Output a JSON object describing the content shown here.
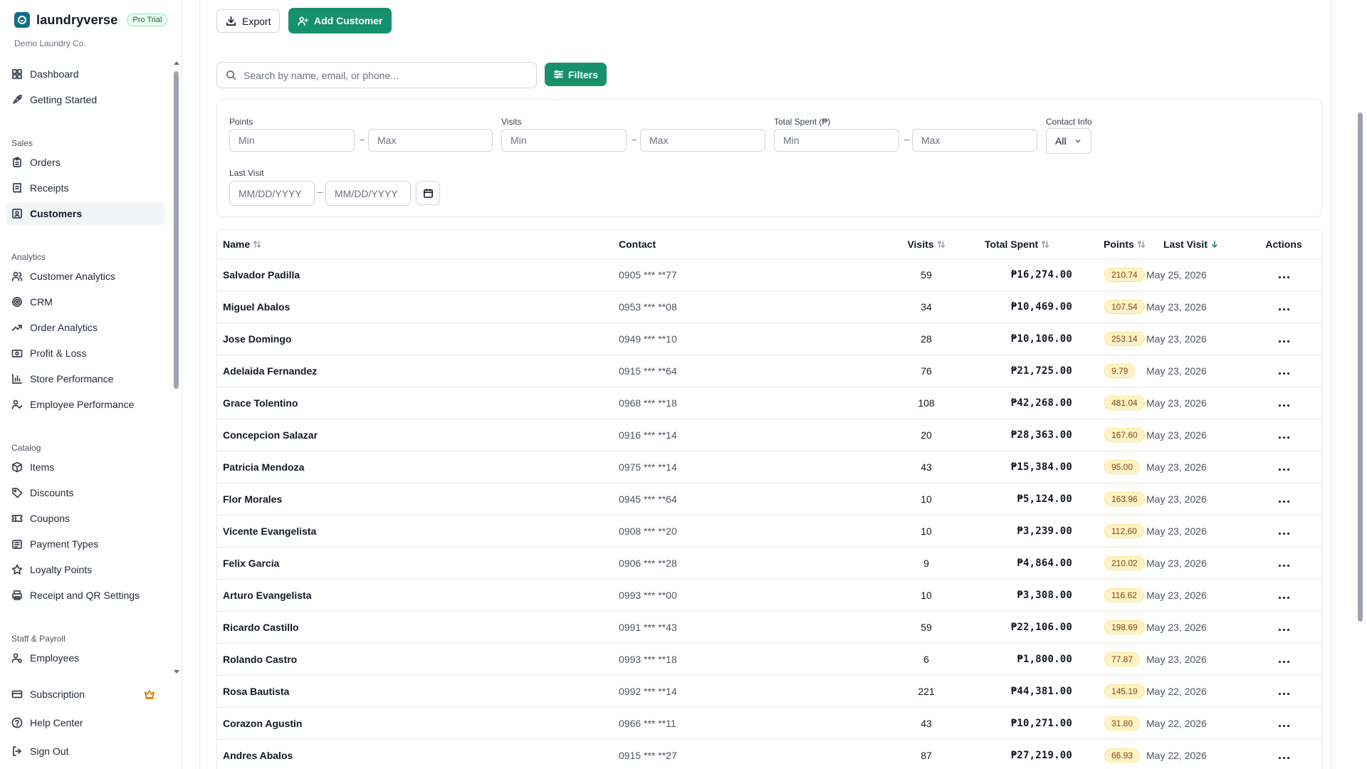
{
  "brand": {
    "name": "laundryverse",
    "badge": "Pro Trial",
    "company": "Demo Laundry Co."
  },
  "sidebar": {
    "top_items": [
      {
        "label": "Dashboard",
        "icon": "grid-icon"
      },
      {
        "label": "Getting Started",
        "icon": "rocket-icon"
      }
    ],
    "sections": [
      {
        "title": "Sales",
        "items": [
          {
            "label": "Orders",
            "icon": "clipboard-icon"
          },
          {
            "label": "Receipts",
            "icon": "receipt-icon"
          },
          {
            "label": "Customers",
            "icon": "contact-icon",
            "active": true
          }
        ]
      },
      {
        "title": "Analytics",
        "items": [
          {
            "label": "Customer Analytics",
            "icon": "users-icon"
          },
          {
            "label": "CRM",
            "icon": "target-icon"
          },
          {
            "label": "Order Analytics",
            "icon": "trend-icon"
          },
          {
            "label": "Profit & Loss",
            "icon": "banknote-icon"
          },
          {
            "label": "Store Performance",
            "icon": "bar-chart-icon"
          },
          {
            "label": "Employee Performance",
            "icon": "user-check-icon"
          }
        ]
      },
      {
        "title": "Catalog",
        "items": [
          {
            "label": "Items",
            "icon": "box-icon"
          },
          {
            "label": "Discounts",
            "icon": "tag-icon"
          },
          {
            "label": "Coupons",
            "icon": "ticket-icon"
          },
          {
            "label": "Payment Types",
            "icon": "wallet-icon"
          },
          {
            "label": "Loyalty Points",
            "icon": "star-icon"
          },
          {
            "label": "Receipt and QR Settings",
            "icon": "printer-icon"
          }
        ]
      },
      {
        "title": "Staff & Payroll",
        "items": [
          {
            "label": "Employees",
            "icon": "user-cog-icon"
          }
        ]
      }
    ],
    "bottom_items": [
      {
        "label": "Subscription",
        "icon": "card-icon"
      },
      {
        "label": "Help Center",
        "icon": "help-icon"
      },
      {
        "label": "Sign Out",
        "icon": "logout-icon"
      }
    ]
  },
  "toolbar": {
    "export_label": "Export",
    "add_label": "Add Customer"
  },
  "search": {
    "placeholder": "Search by name, email, or phone...",
    "value": ""
  },
  "filters": {
    "button_label": "Filters",
    "points_label": "Points",
    "visits_label": "Visits",
    "spent_label": "Total Spent (₱)",
    "contact_label": "Contact Info",
    "contact_value": "All",
    "last_visit_label": "Last Visit",
    "min_placeholder": "Min",
    "max_placeholder": "Max",
    "date_placeholder": "MM/DD/YYYY",
    "dash": "–"
  },
  "table": {
    "columns": {
      "name": "Name",
      "contact": "Contact",
      "visits": "Visits",
      "spent": "Total Spent",
      "points": "Points",
      "last_visit": "Last Visit",
      "actions": "Actions"
    },
    "rows": [
      {
        "name": "Salvador Padilla",
        "contact": "0905 *** **77",
        "visits": "59",
        "spent": "₱16,274.00",
        "points": "210.74",
        "last_visit": "May 25, 2026"
      },
      {
        "name": "Miguel Abalos",
        "contact": "0953 *** **08",
        "visits": "34",
        "spent": "₱10,469.00",
        "points": "107.54",
        "last_visit": "May 23, 2026"
      },
      {
        "name": "Jose Domingo",
        "contact": "0949 *** **10",
        "visits": "28",
        "spent": "₱10,106.00",
        "points": "253.14",
        "last_visit": "May 23, 2026"
      },
      {
        "name": "Adelaida Fernandez",
        "contact": "0915 *** **64",
        "visits": "76",
        "spent": "₱21,725.00",
        "points": "9.79",
        "last_visit": "May 23, 2026"
      },
      {
        "name": "Grace Tolentino",
        "contact": "0968 *** **18",
        "visits": "108",
        "spent": "₱42,268.00",
        "points": "481.04",
        "last_visit": "May 23, 2026"
      },
      {
        "name": "Concepcion Salazar",
        "contact": "0916 *** **14",
        "visits": "20",
        "spent": "₱28,363.00",
        "points": "167.60",
        "last_visit": "May 23, 2026"
      },
      {
        "name": "Patricia Mendoza",
        "contact": "0975 *** **14",
        "visits": "43",
        "spent": "₱15,384.00",
        "points": "95.00",
        "last_visit": "May 23, 2026"
      },
      {
        "name": "Flor Morales",
        "contact": "0945 *** **64",
        "visits": "10",
        "spent": "₱5,124.00",
        "points": "163.96",
        "last_visit": "May 23, 2026"
      },
      {
        "name": "Vicente Evangelista",
        "contact": "0908 *** **20",
        "visits": "10",
        "spent": "₱3,239.00",
        "points": "112.60",
        "last_visit": "May 23, 2026"
      },
      {
        "name": "Felix Garcia",
        "contact": "0906 *** **28",
        "visits": "9",
        "spent": "₱4,864.00",
        "points": "210.02",
        "last_visit": "May 23, 2026"
      },
      {
        "name": "Arturo Evangelista",
        "contact": "0993 *** **00",
        "visits": "10",
        "spent": "₱3,308.00",
        "points": "116.62",
        "last_visit": "May 23, 2026"
      },
      {
        "name": "Ricardo Castillo",
        "contact": "0991 *** **43",
        "visits": "59",
        "spent": "₱22,106.00",
        "points": "198.69",
        "last_visit": "May 23, 2026"
      },
      {
        "name": "Rolando Castro",
        "contact": "0993 *** **18",
        "visits": "6",
        "spent": "₱1,800.00",
        "points": "77.87",
        "last_visit": "May 23, 2026"
      },
      {
        "name": "Rosa Bautista",
        "contact": "0992 *** **14",
        "visits": "221",
        "spent": "₱44,381.00",
        "points": "145.19",
        "last_visit": "May 22, 2026"
      },
      {
        "name": "Corazon Agustin",
        "contact": "0966 *** **11",
        "visits": "43",
        "spent": "₱10,271.00",
        "points": "31.80",
        "last_visit": "May 22, 2026"
      },
      {
        "name": "Andres Abalos",
        "contact": "0915 *** **27",
        "visits": "87",
        "spent": "₱27,219.00",
        "points": "66.93",
        "last_visit": "May 22, 2026"
      }
    ]
  },
  "colors": {
    "primary": "#16916b",
    "points_bg": "#fef3c7",
    "points_text": "#92400e",
    "brand_logo": "#0e6f8a",
    "crown": "#d97706"
  }
}
